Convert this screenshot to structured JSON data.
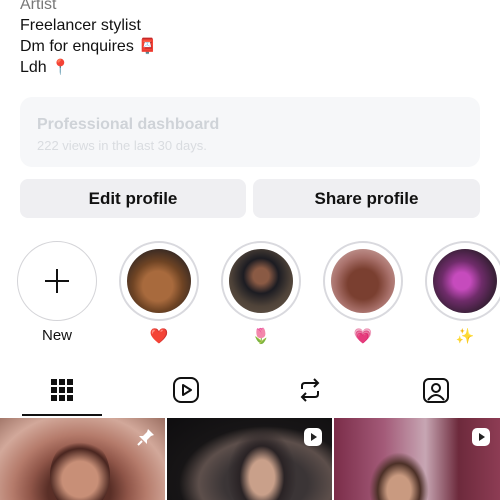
{
  "bio": {
    "category": "Artist",
    "line1": "Freelancer stylist",
    "line2_text": "Dm for enquires",
    "line2_emoji": "📮",
    "line3_text": "Ldh",
    "line3_emoji": "📍"
  },
  "dashboard": {
    "title": "Professional dashboard",
    "subtitle": "222 views in the last 30 days."
  },
  "buttons": {
    "edit": "Edit profile",
    "share": "Share profile"
  },
  "highlights": [
    {
      "label": "New",
      "icon": "plus-icon"
    },
    {
      "label": "❤️",
      "icon": "red-heart"
    },
    {
      "label": "🌷",
      "icon": "tulip"
    },
    {
      "label": "💗",
      "icon": "pink-heart"
    },
    {
      "label": "✨",
      "icon": "sparkles"
    }
  ],
  "tabs": [
    {
      "name": "grid-icon",
      "active": true
    },
    {
      "name": "reels-icon",
      "active": false
    },
    {
      "name": "reposts-icon",
      "active": false
    },
    {
      "name": "tagged-icon",
      "active": false
    }
  ],
  "posts": [
    {
      "badge": "pin-icon"
    },
    {
      "badge": "reel-icon"
    },
    {
      "badge": "reel-icon"
    }
  ],
  "colors": {
    "text": "#111111",
    "muted": "#777777",
    "button_bg": "#efeff2",
    "ring": "#d9d9de"
  }
}
